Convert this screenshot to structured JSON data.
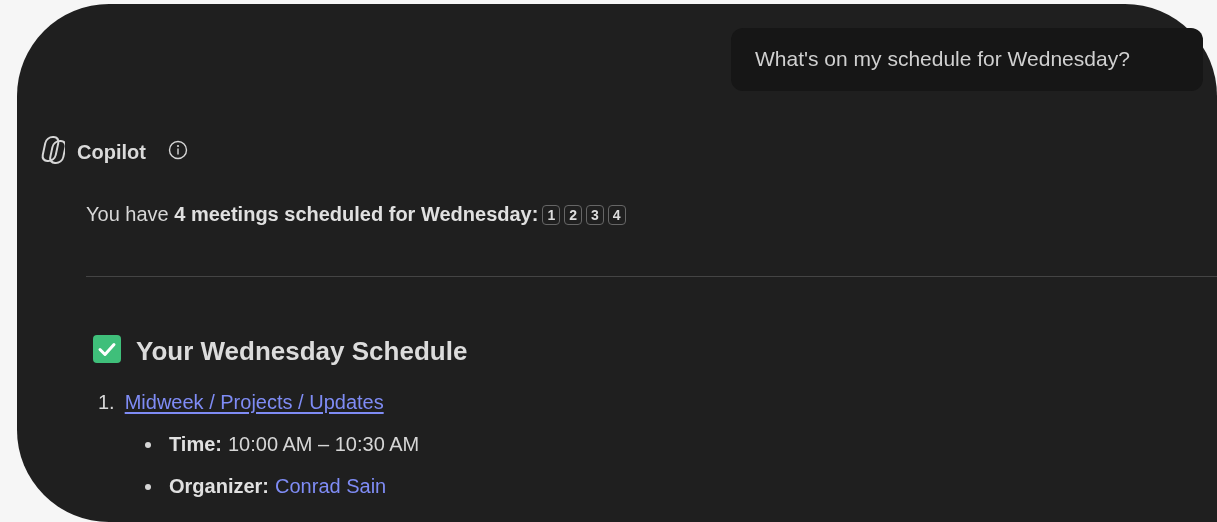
{
  "user_message": "What's on my schedule for Wednesday?",
  "assistant": {
    "name": "Copilot",
    "summary": "You have **4 meetings scheduled for Wednesday:**",
    "citations": [
      "1",
      "2",
      "3",
      "4"
    ]
  },
  "heading": "Your Wednesday Schedule",
  "meetings": [
    {
      "number": "1.",
      "title": "Midweek / Projects / Updates",
      "details": [
        {
          "label": "Time:",
          "value": "10:00 AM – 10:30 AM",
          "kind": "text"
        },
        {
          "label": "Organizer:",
          "value": "Conrad Sain",
          "kind": "link"
        }
      ]
    }
  ]
}
